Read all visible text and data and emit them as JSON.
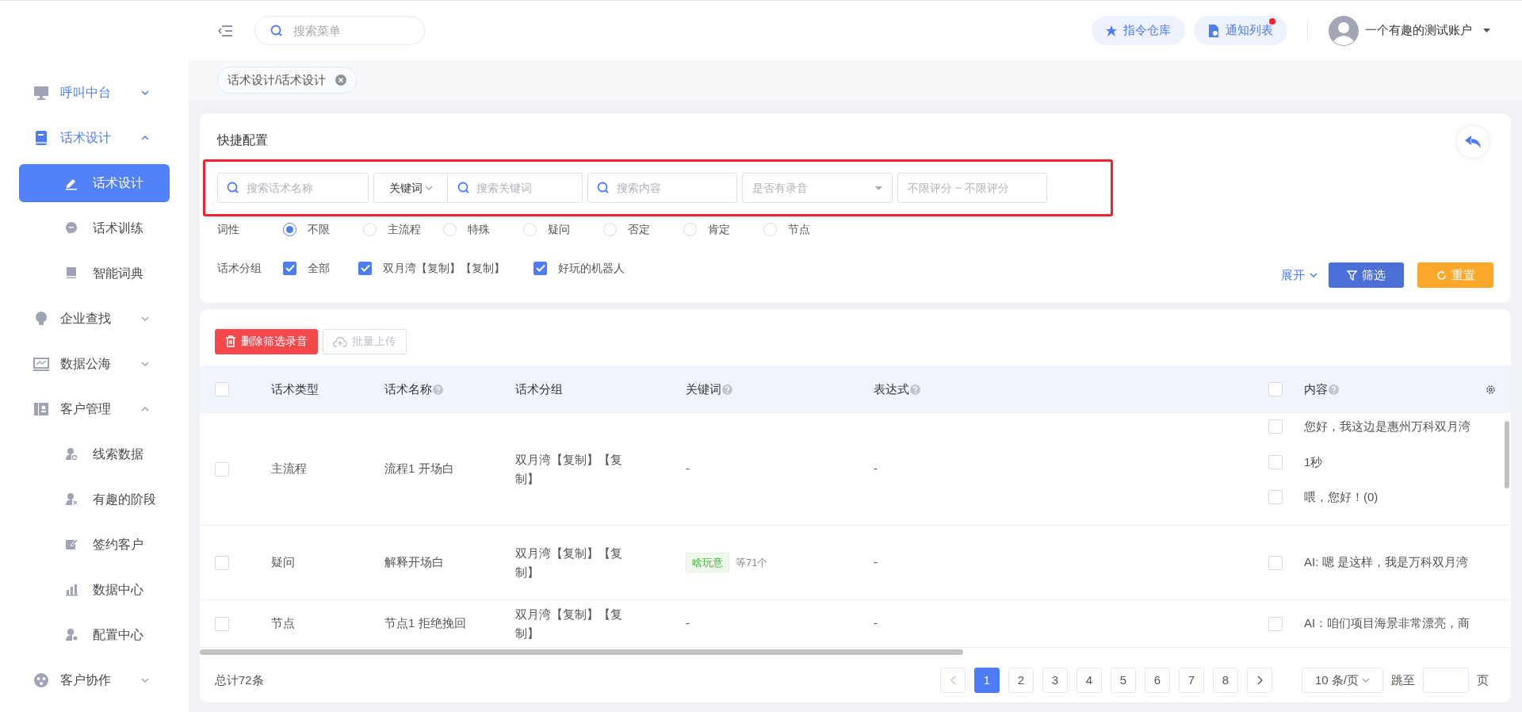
{
  "sidebar": {
    "items": [
      {
        "label": "呼叫中台",
        "highlighted": true,
        "expanded": false
      },
      {
        "label": "话术设计",
        "highlighted": true,
        "expanded": true,
        "children": [
          {
            "label": "话术设计",
            "selected": true
          },
          {
            "label": "话术训练",
            "selected": false
          },
          {
            "label": "智能词典",
            "selected": false
          }
        ]
      },
      {
        "label": "企业查找",
        "highlighted": false,
        "expanded": false
      },
      {
        "label": "数据公海",
        "highlighted": false,
        "expanded": false
      },
      {
        "label": "客户管理",
        "highlighted": false,
        "expanded": true,
        "children": [
          {
            "label": "线索数据",
            "selected": false
          },
          {
            "label": "有趣的阶段",
            "selected": false
          },
          {
            "label": "签约客户",
            "selected": false
          },
          {
            "label": "数据中心",
            "selected": false
          },
          {
            "label": "配置中心",
            "selected": false
          }
        ]
      },
      {
        "label": "客户协作",
        "highlighted": false,
        "expanded": false
      }
    ]
  },
  "header": {
    "menu_search": {
      "placeholder": "搜索菜单"
    },
    "buttons": [
      {
        "label": "指令仓库",
        "unread": false
      },
      {
        "label": "通知列表",
        "unread": true
      }
    ],
    "user": {
      "name": "一个有趣的测试账户"
    }
  },
  "tabs": [
    {
      "label": "话术设计/话术设计"
    }
  ],
  "quick_config": {
    "title": "快捷配置",
    "name_search": {
      "placeholder": "搜索话术名称"
    },
    "keyword_mode": {
      "value": "关键词"
    },
    "keyword_search": {
      "placeholder": "搜索关键词"
    },
    "content_search": {
      "placeholder": "搜索内容"
    },
    "recording_select": {
      "placeholder": "是否有录音"
    },
    "rating_range": {
      "placeholder": "不限评分 ~ 不限评分"
    },
    "part_of_speech": {
      "label": "词性",
      "options": [
        {
          "label": "不限",
          "selected": true
        },
        {
          "label": "主流程",
          "selected": false
        },
        {
          "label": "特殊",
          "selected": false
        },
        {
          "label": "疑问",
          "selected": false
        },
        {
          "label": "否定",
          "selected": false
        },
        {
          "label": "肯定",
          "selected": false
        },
        {
          "label": "节点",
          "selected": false
        }
      ]
    },
    "groups": {
      "label": "话术分组",
      "options": [
        {
          "label": "全部",
          "checked": true
        },
        {
          "label": "双月湾【复制】【复制】",
          "checked": true
        },
        {
          "label": "好玩的机器人",
          "checked": true
        }
      ]
    },
    "expand_link": "展开",
    "filter_button": "筛选",
    "reset_button": "重置"
  },
  "table": {
    "toolbar": [
      {
        "label": "删除筛选录音",
        "kind": "danger",
        "disabled": false
      },
      {
        "label": "批量上传",
        "kind": "upload",
        "disabled": true
      }
    ],
    "header_checkboxes": [
      {
        "checked": false
      },
      {
        "checked": false
      }
    ],
    "columns": [
      {
        "label": "话术类型",
        "help": false
      },
      {
        "label": "话术名称",
        "help": true
      },
      {
        "label": "话术分组",
        "help": false
      },
      {
        "label": "关键词",
        "help": true
      },
      {
        "label": "表达式",
        "help": true
      },
      {
        "label": "内容",
        "help": true
      }
    ],
    "rows": [
      {
        "checked": false,
        "type": "主流程",
        "name": "流程1 开场白",
        "group": "双月湾【复制】【复制】",
        "keywords": {
          "kind": "plain",
          "text": "-"
        },
        "expression": "-",
        "contents": [
          {
            "text": "您好，我这边是惠州万科双月湾",
            "checked": false
          },
          {
            "text": "1秒",
            "checked": false
          },
          {
            "text": "喂，您好！(0)",
            "checked": false
          }
        ]
      },
      {
        "checked": false,
        "type": "疑问",
        "name": "解释开场白",
        "group": "双月湾【复制】【复制】",
        "keywords": {
          "kind": "tag",
          "tag": "啥玩意",
          "more": "等71个"
        },
        "expression": "-",
        "contents": [
          {
            "text": "AI: 嗯 是这样，我是万科双月湾",
            "checked": false
          }
        ]
      },
      {
        "checked": false,
        "type": "节点",
        "name": "节点1 拒绝挽回",
        "group": "双月湾【复制】【复制】",
        "keywords": {
          "kind": "plain",
          "text": "-"
        },
        "expression": "-",
        "contents": [
          {
            "text": "AI：咱们项目海景非常漂亮，商",
            "checked": false
          }
        ]
      }
    ],
    "total": "总计72条",
    "pagination": {
      "prev": {
        "disabled": true
      },
      "pages": [
        {
          "label": "1",
          "selected": true
        },
        {
          "label": "2",
          "selected": false
        },
        {
          "label": "3",
          "selected": false
        },
        {
          "label": "4",
          "selected": false
        },
        {
          "label": "5",
          "selected": false
        },
        {
          "label": "6",
          "selected": false
        },
        {
          "label": "7",
          "selected": false
        },
        {
          "label": "8",
          "selected": false
        }
      ],
      "next": {
        "disabled": false
      },
      "page_size": "10 条/页",
      "jump_label": "跳至",
      "page_unit": "页"
    }
  }
}
